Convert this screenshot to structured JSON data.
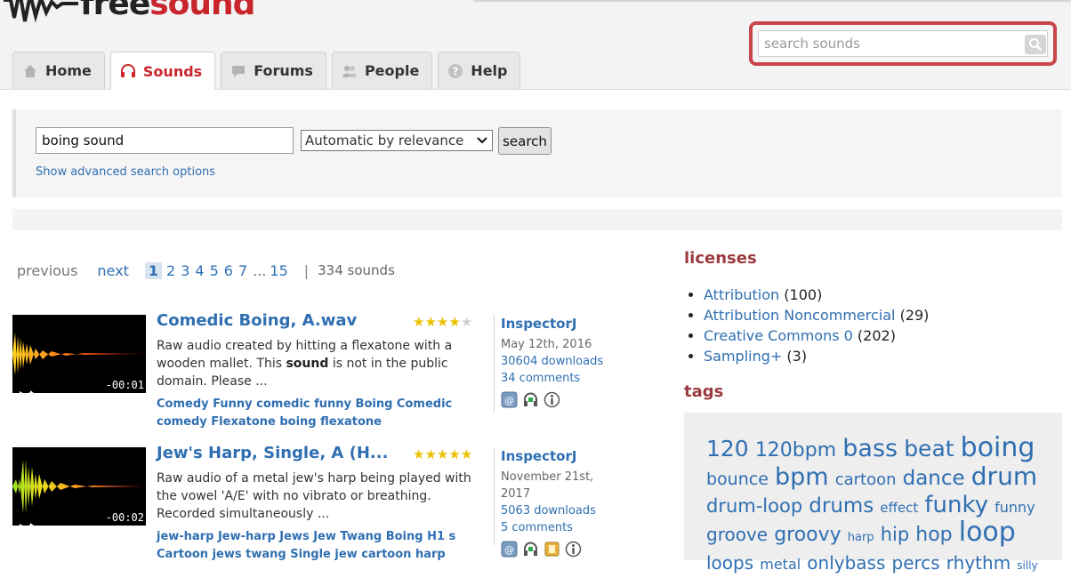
{
  "header": {
    "logo": {
      "part1": "free",
      "part2": "sound"
    },
    "search_placeholder": "search sounds",
    "tabs": [
      {
        "label": "Home",
        "icon": "home-icon"
      },
      {
        "label": "Sounds",
        "icon": "headphones-icon",
        "active": true
      },
      {
        "label": "Forums",
        "icon": "speech-bubble-icon"
      },
      {
        "label": "People",
        "icon": "people-icon"
      },
      {
        "label": "Help",
        "icon": "help-icon"
      }
    ]
  },
  "search": {
    "query": "boing sound",
    "sort_selected": "Automatic by relevance",
    "button": "search",
    "advanced_link": "Show advanced search options"
  },
  "pagination": {
    "previous": "previous",
    "next": "next",
    "current": "1",
    "pages": [
      "2",
      "3",
      "4",
      "5",
      "6",
      "7"
    ],
    "ellipsis": "...",
    "last": "15",
    "separator": "|",
    "count": "334 sounds"
  },
  "sounds": [
    {
      "title": "Comedic Boing, A.wav",
      "rating": 4,
      "desc_before": "Raw audio created by hitting a flexatone with a wooden mallet. This ",
      "desc_bold": "sound",
      "desc_after": " is not in the public domain. Please ...",
      "tags": "Comedy Funny comedic funny Boing Comedic comedy Flexatone boing flexatone",
      "duration": "-00:01",
      "user": "InspectorJ",
      "date": "May 12th, 2016",
      "downloads": "30604 downloads",
      "comments": "34 comments"
    },
    {
      "title": "Jew's Harp, Single, A (H...",
      "rating": 5,
      "desc_before": "Raw audio of a metal jew's harp being played with the vowel 'A/E' with no vibrato or breathing. Recorded simultaneously ...",
      "desc_bold": "",
      "desc_after": "",
      "tags": "jew-harp Jew-harp Jews Jew Twang Boing H1 s Cartoon jews twang Single jew cartoon harp",
      "duration": "-00:02",
      "user": "InspectorJ",
      "date": "November 21st, 2017",
      "downloads": "5063 downloads",
      "comments": "5 comments"
    }
  ],
  "sidebar": {
    "licenses_title": "licenses",
    "licenses": [
      {
        "name": "Attribution",
        "count": "(100)"
      },
      {
        "name": "Attribution Noncommercial",
        "count": "(29)"
      },
      {
        "name": "Creative Commons 0",
        "count": "(202)"
      },
      {
        "name": "Sampling+",
        "count": "(3)"
      }
    ],
    "tags_title": "tags",
    "tags": [
      {
        "t": "120",
        "s": 25
      },
      {
        "t": "120bpm",
        "s": 22
      },
      {
        "t": "bass",
        "s": 27
      },
      {
        "t": "beat",
        "s": 25
      },
      {
        "t": "boing",
        "s": 30
      },
      {
        "t": "bounce",
        "s": 19
      },
      {
        "t": "bpm",
        "s": 27
      },
      {
        "t": "cartoon",
        "s": 18
      },
      {
        "t": "dance",
        "s": 23
      },
      {
        "t": "drum",
        "s": 28
      },
      {
        "t": "drum-loop",
        "s": 21
      },
      {
        "t": "drums",
        "s": 23
      },
      {
        "t": "effect",
        "s": 15
      },
      {
        "t": "funky",
        "s": 26
      },
      {
        "t": "funny",
        "s": 16
      },
      {
        "t": "groove",
        "s": 20
      },
      {
        "t": "groovy",
        "s": 22
      },
      {
        "t": "harp",
        "s": 13
      },
      {
        "t": "hip",
        "s": 21
      },
      {
        "t": "hop",
        "s": 22
      },
      {
        "t": "loop",
        "s": 30
      },
      {
        "t": "loops",
        "s": 20
      },
      {
        "t": "metal",
        "s": 16
      },
      {
        "t": "onlybass",
        "s": 20
      },
      {
        "t": "percs",
        "s": 20
      },
      {
        "t": "rhythm",
        "s": 20
      },
      {
        "t": "silly",
        "s": 12
      }
    ]
  }
}
